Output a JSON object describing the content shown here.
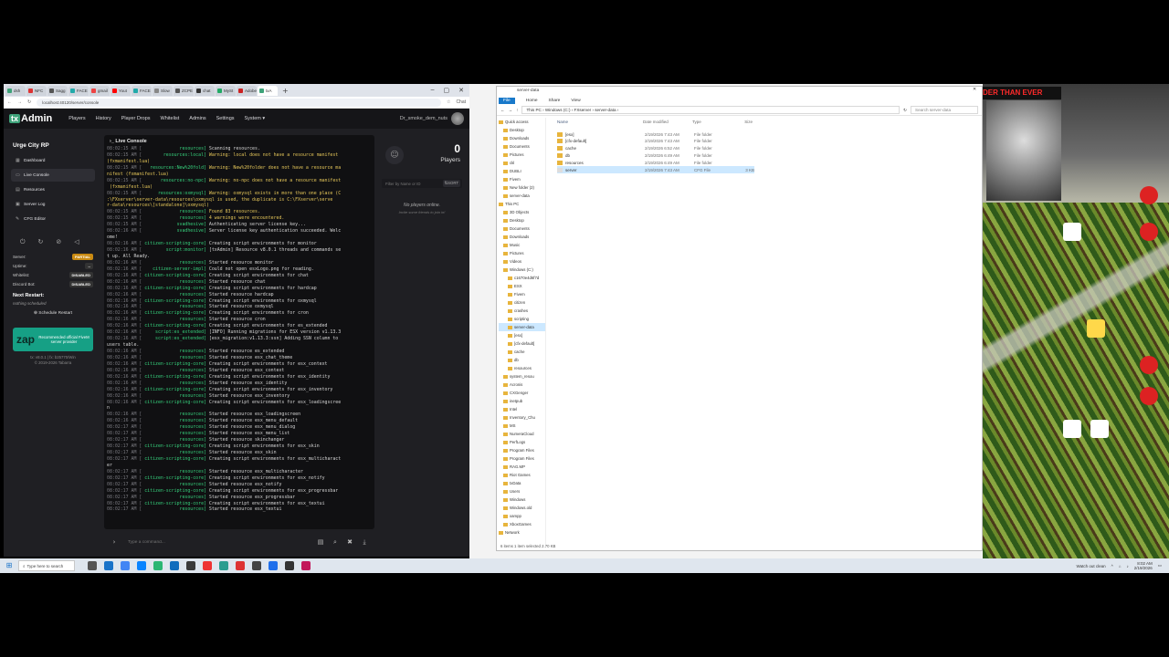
{
  "browser": {
    "tabs": [
      {
        "label": "dsh",
        "color": "#3ea37a"
      },
      {
        "label": "NFC",
        "color": "#d33"
      },
      {
        "label": "Sagg",
        "color": "#555"
      },
      {
        "label": "FACE",
        "color": "#2aa"
      },
      {
        "label": "gmail",
        "color": "#e44"
      },
      {
        "label": "Yout",
        "color": "#f00"
      },
      {
        "label": "FACE",
        "color": "#2aa"
      },
      {
        "label": "Slow",
        "color": "#888"
      },
      {
        "label": "ZCPE",
        "color": "#555"
      },
      {
        "label": "chat",
        "color": "#333"
      },
      {
        "label": "MySt",
        "color": "#2a6"
      },
      {
        "label": "Adobe",
        "color": "#c22"
      },
      {
        "label": "txA",
        "color": "#3ea37a",
        "active": true
      }
    ],
    "new_tab": "+",
    "url": "localhost:40120/server/console",
    "chat_btn": "Chat"
  },
  "txadmin": {
    "logo_tx": "tx",
    "logo_rest": "Admin",
    "nav": [
      "Players",
      "History",
      "Player Drops",
      "Whitelist",
      "Admins",
      "Settings",
      "System ▾"
    ],
    "username": "Dr_smoke_dem_nuts",
    "server_name": "Urge City RP",
    "menu": [
      "Dashboard",
      "Live Console",
      "Resources",
      "Server Log",
      "CFG Editor"
    ],
    "menu_active": 1,
    "menu_icons": [
      "▦",
      "▭",
      "▤",
      "▣",
      "✎"
    ],
    "controls": [
      "⏻",
      "↻",
      "⊘",
      "◁"
    ],
    "status": [
      {
        "label": "Server:",
        "value": "PARTIAL",
        "color": "#c98a12"
      },
      {
        "label": "Uptime:",
        "value": "--",
        "color": "#333"
      },
      {
        "label": "Whitelist:",
        "value": "DISABLED",
        "color": "#333"
      },
      {
        "label": "Discord Bot:",
        "value": "DISABLED",
        "color": "#333"
      }
    ],
    "next_restart": "Next Restart:",
    "nothing_scheduled": "nothing scheduled",
    "schedule_btn": "⊕ Schedule Restart",
    "zap_logo": "zap",
    "zap_text": "Recommended official FiveM server provider",
    "version": "tx: v8.0.1 | fx: b25770/Win",
    "copyright": "© 2019-2026 Tabarra",
    "console_title": "Live Console",
    "cmd_placeholder": "Type a command...",
    "players_count": "0",
    "players_label": "Players",
    "filter_placeholder": "Filter by Name or ID",
    "filter_sort": "⇅SORT",
    "no_players": "No players online.",
    "invite": "Invite some friends to join in!"
  },
  "console_lines": [
    {
      "ts": "08:02:15 AM",
      "src": "resources]",
      "msg": " Scanning resources."
    },
    {
      "ts": "08:02:15 AM",
      "src": "resources:local]",
      "msg": " Warning: local does not have a resource manifest",
      "warn": true
    },
    {
      "ts": "",
      "src": "",
      "msg": "(fxmanifest.lua)",
      "warn": true
    },
    {
      "ts": "08:02:15 AM",
      "src": "resources:New%20fold]",
      "msg": " Warning: New%20folder does not have a resource ma",
      "warn": true
    },
    {
      "ts": "",
      "src": "",
      "msg": "nifest (fxmanifest.lua)",
      "warn": true
    },
    {
      "ts": "08:02:15 AM",
      "src": "resources:no-npc]",
      "msg": " Warning: no-npc does not have a resource manifest",
      "warn": true
    },
    {
      "ts": "",
      "src": "",
      "msg": " (fxmanifest.lua)",
      "warn": true
    },
    {
      "ts": "08:02:15 AM",
      "src": "resources:oxmysql]",
      "msg": " Warning: oxmysql exists in more than one place (C",
      "warn": true
    },
    {
      "ts": "",
      "src": "",
      "msg": ":\\FXserver\\server-data\\resources\\oxmysql is used, the duplicate is C:\\FXserver\\serve",
      "warn": true
    },
    {
      "ts": "",
      "src": "",
      "msg": "r-data\\resources\\[standalone]\\oxmysql)",
      "warn": true
    },
    {
      "ts": "08:02:15 AM",
      "src": "resources]",
      "msg": " Found 83 resources.",
      "warn": true
    },
    {
      "ts": "08:02:15 AM",
      "src": "resources]",
      "msg": " 4 warnings were encountered.",
      "warn": true
    },
    {
      "ts": "08:02:15 AM",
      "src": "svadhesive]",
      "msg": " Authenticating server license key..."
    },
    {
      "ts": "08:02:16 AM",
      "src": "svadhesive]",
      "msg": " Server license key authentication succeeded. Welc"
    },
    {
      "ts": "",
      "src": "",
      "msg": "ome!"
    },
    {
      "ts": "08:02:16 AM",
      "src": "citizen-scripting-core]",
      "msg": " Creating script environments for monitor"
    },
    {
      "ts": "08:02:16 AM",
      "src": "script:monitor]",
      "msg": " [txAdmin] Resource v8.0.1 threads and commands se"
    },
    {
      "ts": "",
      "src": "",
      "msg": "t up. All Ready."
    },
    {
      "ts": "08:02:16 AM",
      "src": "resources]",
      "msg": " Started resource monitor"
    },
    {
      "ts": "08:02:16 AM",
      "src": "citizen-server-impl]",
      "msg": " Could not open esxLogo.png for reading."
    },
    {
      "ts": "08:02:16 AM",
      "src": "citizen-scripting-core]",
      "msg": " Creating script environments for chat"
    },
    {
      "ts": "08:02:16 AM",
      "src": "resources]",
      "msg": " Started resource chat"
    },
    {
      "ts": "08:02:16 AM",
      "src": "citizen-scripting-core]",
      "msg": " Creating script environments for hardcap"
    },
    {
      "ts": "08:02:16 AM",
      "src": "resources]",
      "msg": " Started resource hardcap"
    },
    {
      "ts": "08:02:16 AM",
      "src": "citizen-scripting-core]",
      "msg": " Creating script environments for oxmysql"
    },
    {
      "ts": "08:02:16 AM",
      "src": "resources]",
      "msg": " Started resource oxmysql"
    },
    {
      "ts": "08:02:16 AM",
      "src": "citizen-scripting-core]",
      "msg": " Creating script environments for cron"
    },
    {
      "ts": "08:02:16 AM",
      "src": "resources]",
      "msg": " Started resource cron"
    },
    {
      "ts": "08:02:16 AM",
      "src": "citizen-scripting-core]",
      "msg": " Creating script environments for es_extended"
    },
    {
      "ts": "08:02:16 AM",
      "src": "script:es_extended]",
      "msg": " [INFO] Running migrations for ESX version v1.13.3"
    },
    {
      "ts": "08:02:16 AM",
      "src": "script:es_extended]",
      "msg": " [esx_migration:v1.13.3:ssn] Adding SSN column to"
    },
    {
      "ts": "",
      "src": "",
      "msg": "users table."
    },
    {
      "ts": "08:02:16 AM",
      "src": "resources]",
      "msg": " Started resource es_extended"
    },
    {
      "ts": "08:02:16 AM",
      "src": "resources]",
      "msg": " Started resource esx_chat_theme"
    },
    {
      "ts": "08:02:16 AM",
      "src": "citizen-scripting-core]",
      "msg": " Creating script environments for esx_context"
    },
    {
      "ts": "08:02:16 AM",
      "src": "resources]",
      "msg": " Started resource esx_context"
    },
    {
      "ts": "08:02:16 AM",
      "src": "citizen-scripting-core]",
      "msg": " Creating script environments for esx_identity"
    },
    {
      "ts": "08:02:16 AM",
      "src": "resources]",
      "msg": " Started resource esx_identity"
    },
    {
      "ts": "08:02:16 AM",
      "src": "citizen-scripting-core]",
      "msg": " Creating script environments for esx_inventory"
    },
    {
      "ts": "08:02:16 AM",
      "src": "resources]",
      "msg": " Started resource esx_inventory"
    },
    {
      "ts": "08:02:16 AM",
      "src": "citizen-scripting-core]",
      "msg": " Creating script environments for esx_loadingscree"
    },
    {
      "ts": "",
      "src": "",
      "msg": "n"
    },
    {
      "ts": "08:02:16 AM",
      "src": "resources]",
      "msg": " Started resource esx_loadingscreen"
    },
    {
      "ts": "08:02:16 AM",
      "src": "resources]",
      "msg": " Started resource esx_menu_default"
    },
    {
      "ts": "08:02:17 AM",
      "src": "resources]",
      "msg": " Started resource esx_menu_dialog"
    },
    {
      "ts": "08:02:17 AM",
      "src": "resources]",
      "msg": " Started resource esx_menu_list"
    },
    {
      "ts": "08:02:17 AM",
      "src": "resources]",
      "msg": " Started resource skinchanger"
    },
    {
      "ts": "08:02:17 AM",
      "src": "citizen-scripting-core]",
      "msg": " Creating script environments for esx_skin"
    },
    {
      "ts": "08:02:17 AM",
      "src": "resources]",
      "msg": " Started resource esx_skin"
    },
    {
      "ts": "08:02:17 AM",
      "src": "citizen-scripting-core]",
      "msg": " Creating script environments for esx_multicharact"
    },
    {
      "ts": "",
      "src": "",
      "msg": "er"
    },
    {
      "ts": "08:02:17 AM",
      "src": "resources]",
      "msg": " Started resource esx_multicharacter"
    },
    {
      "ts": "08:02:17 AM",
      "src": "citizen-scripting-core]",
      "msg": " Creating script environments for esx_notify"
    },
    {
      "ts": "08:02:17 AM",
      "src": "resources]",
      "msg": " Started resource esx_notify"
    },
    {
      "ts": "08:02:17 AM",
      "src": "citizen-scripting-core]",
      "msg": " Creating script environments for esx_progressbar"
    },
    {
      "ts": "08:02:17 AM",
      "src": "resources]",
      "msg": " Started resource esx_progressbar"
    },
    {
      "ts": "08:02:17 AM",
      "src": "citizen-scripting-core]",
      "msg": " Creating script environments for esx_textui"
    },
    {
      "ts": "08:02:17 AM",
      "src": "resources]",
      "msg": " Started resource esx_textui"
    }
  ],
  "explorer": {
    "title": "server-data",
    "ribbon": [
      "File",
      "Home",
      "Share",
      "View"
    ],
    "path": "This PC › Windows (C:) › FXserver › server-data ›",
    "search": "Search server-data",
    "columns": [
      "Name",
      "Date modified",
      "Type",
      "Size"
    ],
    "tree": [
      "Quick access",
      "Desktop",
      "Downloads",
      "Documents",
      "Pictures",
      "ckl",
      "DUBLI",
      "Fivem",
      "New folder (2)",
      "server-data",
      "This PC",
      "3D Objects",
      "Desktop",
      "Documents",
      "Downloads",
      "Music",
      "Pictures",
      "Videos",
      "Windows (C:)",
      "c1670e4d6f7d",
      "ESX",
      "Fivem",
      "citizen",
      "crashes",
      "scripting",
      "server-data",
      "[esx]",
      "[cfx-default]",
      "cache",
      "db",
      "resources",
      "system_resou",
      "Acronis",
      "CXGenger",
      "inetpub",
      "Intel",
      "Inventory_Chu",
      "MS",
      "NumeraCloud",
      "PerfLogs",
      "Program Files",
      "Program Files",
      "RAG.MP",
      "Riot Games",
      "txData",
      "Users",
      "Windows",
      "Windows.old",
      "xampp",
      "XboxGames",
      "Network"
    ],
    "tree_selected": 25,
    "rows": [
      {
        "name": "[esx]",
        "date": "2/19/2026 7:43 AM",
        "type": "File folder",
        "size": ""
      },
      {
        "name": "[cfx-default]",
        "date": "2/19/2026 7:43 AM",
        "type": "File folder",
        "size": ""
      },
      {
        "name": "cache",
        "date": "2/19/2026 6:52 AM",
        "type": "File folder",
        "size": ""
      },
      {
        "name": "db",
        "date": "2/19/2026 6:49 AM",
        "type": "File folder",
        "size": ""
      },
      {
        "name": "resources",
        "date": "2/19/2026 6:49 AM",
        "type": "File folder",
        "size": ""
      },
      {
        "name": "server",
        "date": "2/19/2026 7:43 AM",
        "type": "CFG File",
        "size": "3 KB"
      }
    ],
    "status": "6 items   1 item selected  2.70 KB"
  },
  "desktop": {
    "promo": "DER THAN EVER"
  },
  "taskbar": {
    "search": "Type here to search",
    "tray_app": "Watch out clean",
    "time": "8:02 AM",
    "date": "2/19/2026"
  }
}
